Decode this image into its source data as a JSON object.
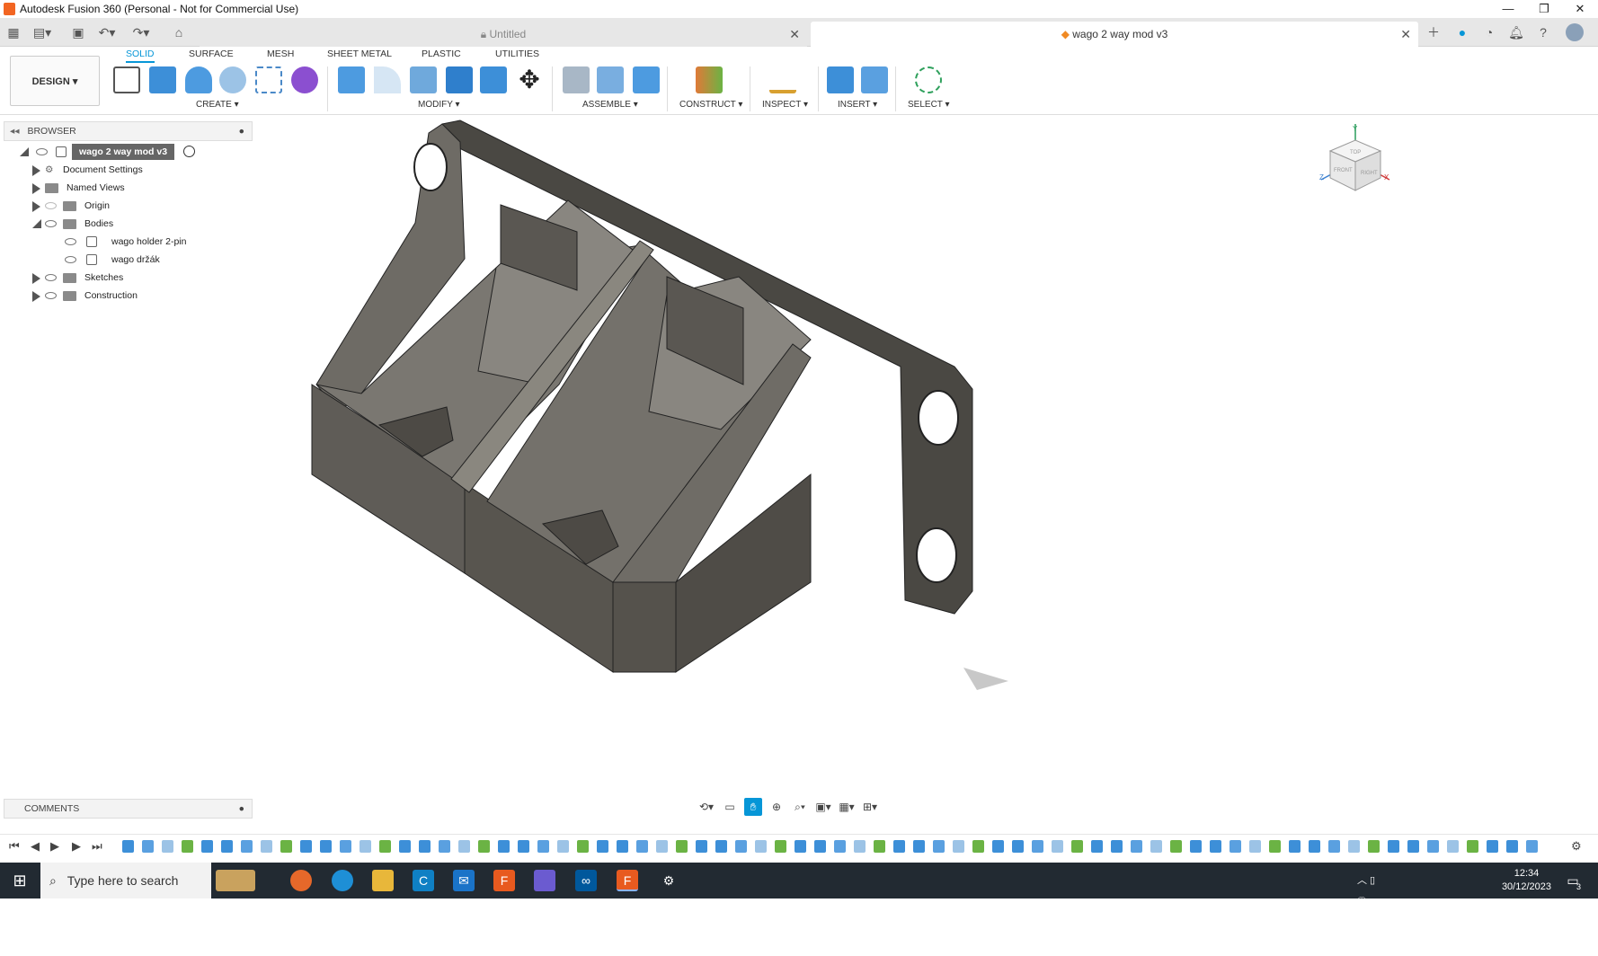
{
  "window": {
    "title": "Autodesk Fusion 360 (Personal - Not for Commercial Use)",
    "minimize": "—",
    "restore": "❐",
    "close": "✕"
  },
  "tabs": [
    {
      "label": "Untitled",
      "close": "✕"
    },
    {
      "label": "wago 2 way mod v3",
      "close": "✕"
    }
  ],
  "ribbon": {
    "tabs": [
      "SOLID",
      "SURFACE",
      "MESH",
      "SHEET METAL",
      "PLASTIC",
      "UTILITIES"
    ],
    "design_label": "DESIGN ▾",
    "groups": [
      "CREATE ▾",
      "MODIFY ▾",
      "ASSEMBLE ▾",
      "CONSTRUCT ▾",
      "INSPECT ▾",
      "INSERT ▾",
      "SELECT ▾"
    ]
  },
  "browser": {
    "header": "BROWSER",
    "root": "wago 2 way mod v3",
    "items": [
      "Document Settings",
      "Named Views",
      "Origin",
      "Bodies",
      "wago holder 2-pin",
      "wago držák",
      "Sketches",
      "Construction"
    ]
  },
  "comments": {
    "header": "COMMENTS"
  },
  "viewcube": {
    "top": "TOP",
    "front": "FRONT",
    "right": "RIGHT",
    "x": "X",
    "y": "Y",
    "z": "Z"
  },
  "taskbar": {
    "search_placeholder": "Type here to search",
    "time": "12:34",
    "date": "30/12/2023",
    "notif_count": "3"
  },
  "colors": {
    "accent": "#0696d7",
    "model": "#5a5853",
    "taskbar": "#222a32"
  }
}
